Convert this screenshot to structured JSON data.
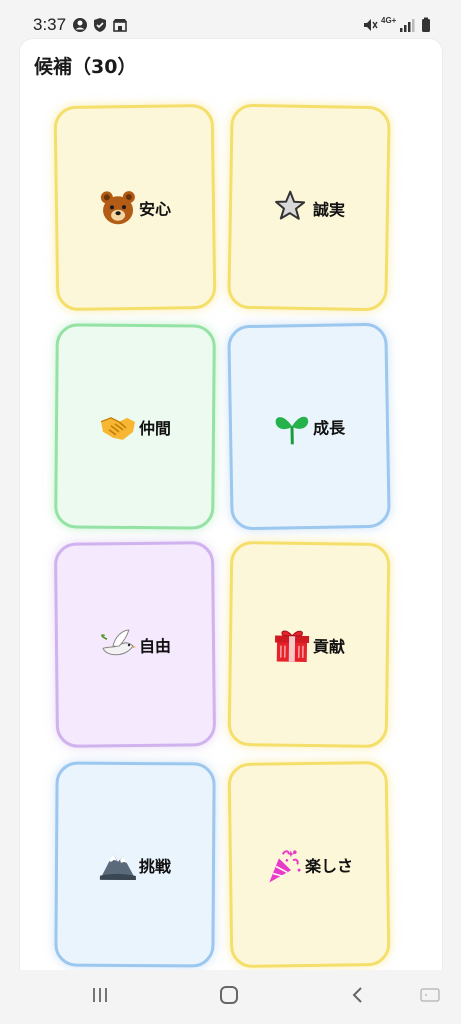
{
  "status_bar": {
    "time": "3:37",
    "icons": [
      "account-circle-icon",
      "shield-check-icon",
      "store-icon",
      "mute-icon",
      "4g-signal-icon",
      "cell-signal-icon",
      "battery-icon"
    ],
    "network_label": "4G+"
  },
  "panel": {
    "title": "候補（30）"
  },
  "cards": [
    {
      "label": "安心",
      "emoji": "bear-icon",
      "color": "yellow"
    },
    {
      "label": "誠実",
      "emoji": "star-icon",
      "color": "yellow"
    },
    {
      "label": "仲間",
      "emoji": "handshake-icon",
      "color": "green"
    },
    {
      "label": "成長",
      "emoji": "seedling-icon",
      "color": "blue"
    },
    {
      "label": "自由",
      "emoji": "dove-icon",
      "color": "purple"
    },
    {
      "label": "貢献",
      "emoji": "gift-icon",
      "color": "yellow"
    },
    {
      "label": "挑戦",
      "emoji": "mountain-icon",
      "color": "blue"
    },
    {
      "label": "楽しさ",
      "emoji": "party-popper-icon",
      "color": "yellow"
    }
  ],
  "nav_bar": {
    "buttons": [
      "recents-button",
      "home-button",
      "back-button",
      "keyboard-button"
    ]
  }
}
